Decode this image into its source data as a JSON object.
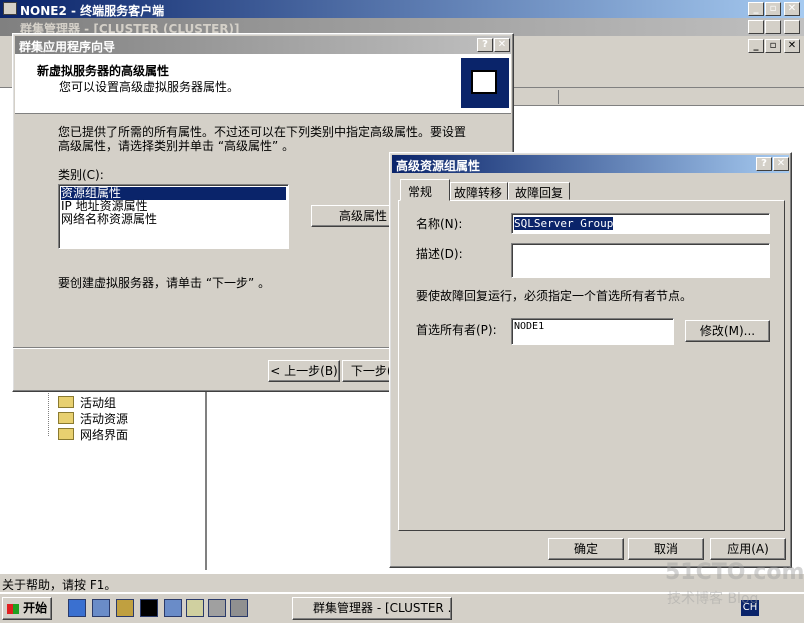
{
  "rdp": {
    "title": "NONE2 - 终端服务客户端",
    "minimize": "_",
    "restore": "▫",
    "close": "✕"
  },
  "mmc": {
    "title": "群集管理器 - [CLUSTER (CLUSTER)]",
    "tree_items": [
      "活动组",
      "活动资源",
      "网络界面"
    ]
  },
  "wizard": {
    "title": "群集应用程序向导",
    "help": "?",
    "close": "✕",
    "header_title": "新虚拟服务器的高级属性",
    "header_sub": "您可以设置高级虚拟服务器属性。",
    "desc_line1": "您已提供了所需的所有属性。不过还可以在下列类别中指定高级属性。要设置",
    "desc_line2": "高级属性，请选择类别并单击 “高级属性” 。",
    "category_label": "类别(C):",
    "categories": [
      "资源组属性",
      "IP 地址资源属性",
      "网络名称资源属性"
    ],
    "adv_button": "高级属性",
    "footer_text": "要创建虚拟服务器，请单击 “下一步” 。",
    "back_button": "< 上一步(B)",
    "next_button": "下一步(N)"
  },
  "dialog": {
    "title": "高级资源组属性",
    "help": "?",
    "close": "✕",
    "tabs": [
      "常规",
      "故障转移",
      "故障回复"
    ],
    "name_label": "名称(N):",
    "name_value": "SQLServer Group",
    "desc_label": "描述(D):",
    "desc_value": "",
    "note": "要使故障回复运行，必须指定一个首选所有者节点。",
    "owner_label": "首选所有者(P):",
    "owner_value": "NODE1",
    "modify_button": "修改(M)...",
    "ok": "确定",
    "cancel": "取消",
    "apply": "应用(A)"
  },
  "status_bar": {
    "text": "关于帮助，请按 F1。"
  },
  "taskbar": {
    "start": "开始",
    "task": "群集管理器 - [CLUSTER ...",
    "lang": "CH"
  },
  "watermark": {
    "line1": "51CTO.com",
    "line2": "技术博客 Blog"
  }
}
